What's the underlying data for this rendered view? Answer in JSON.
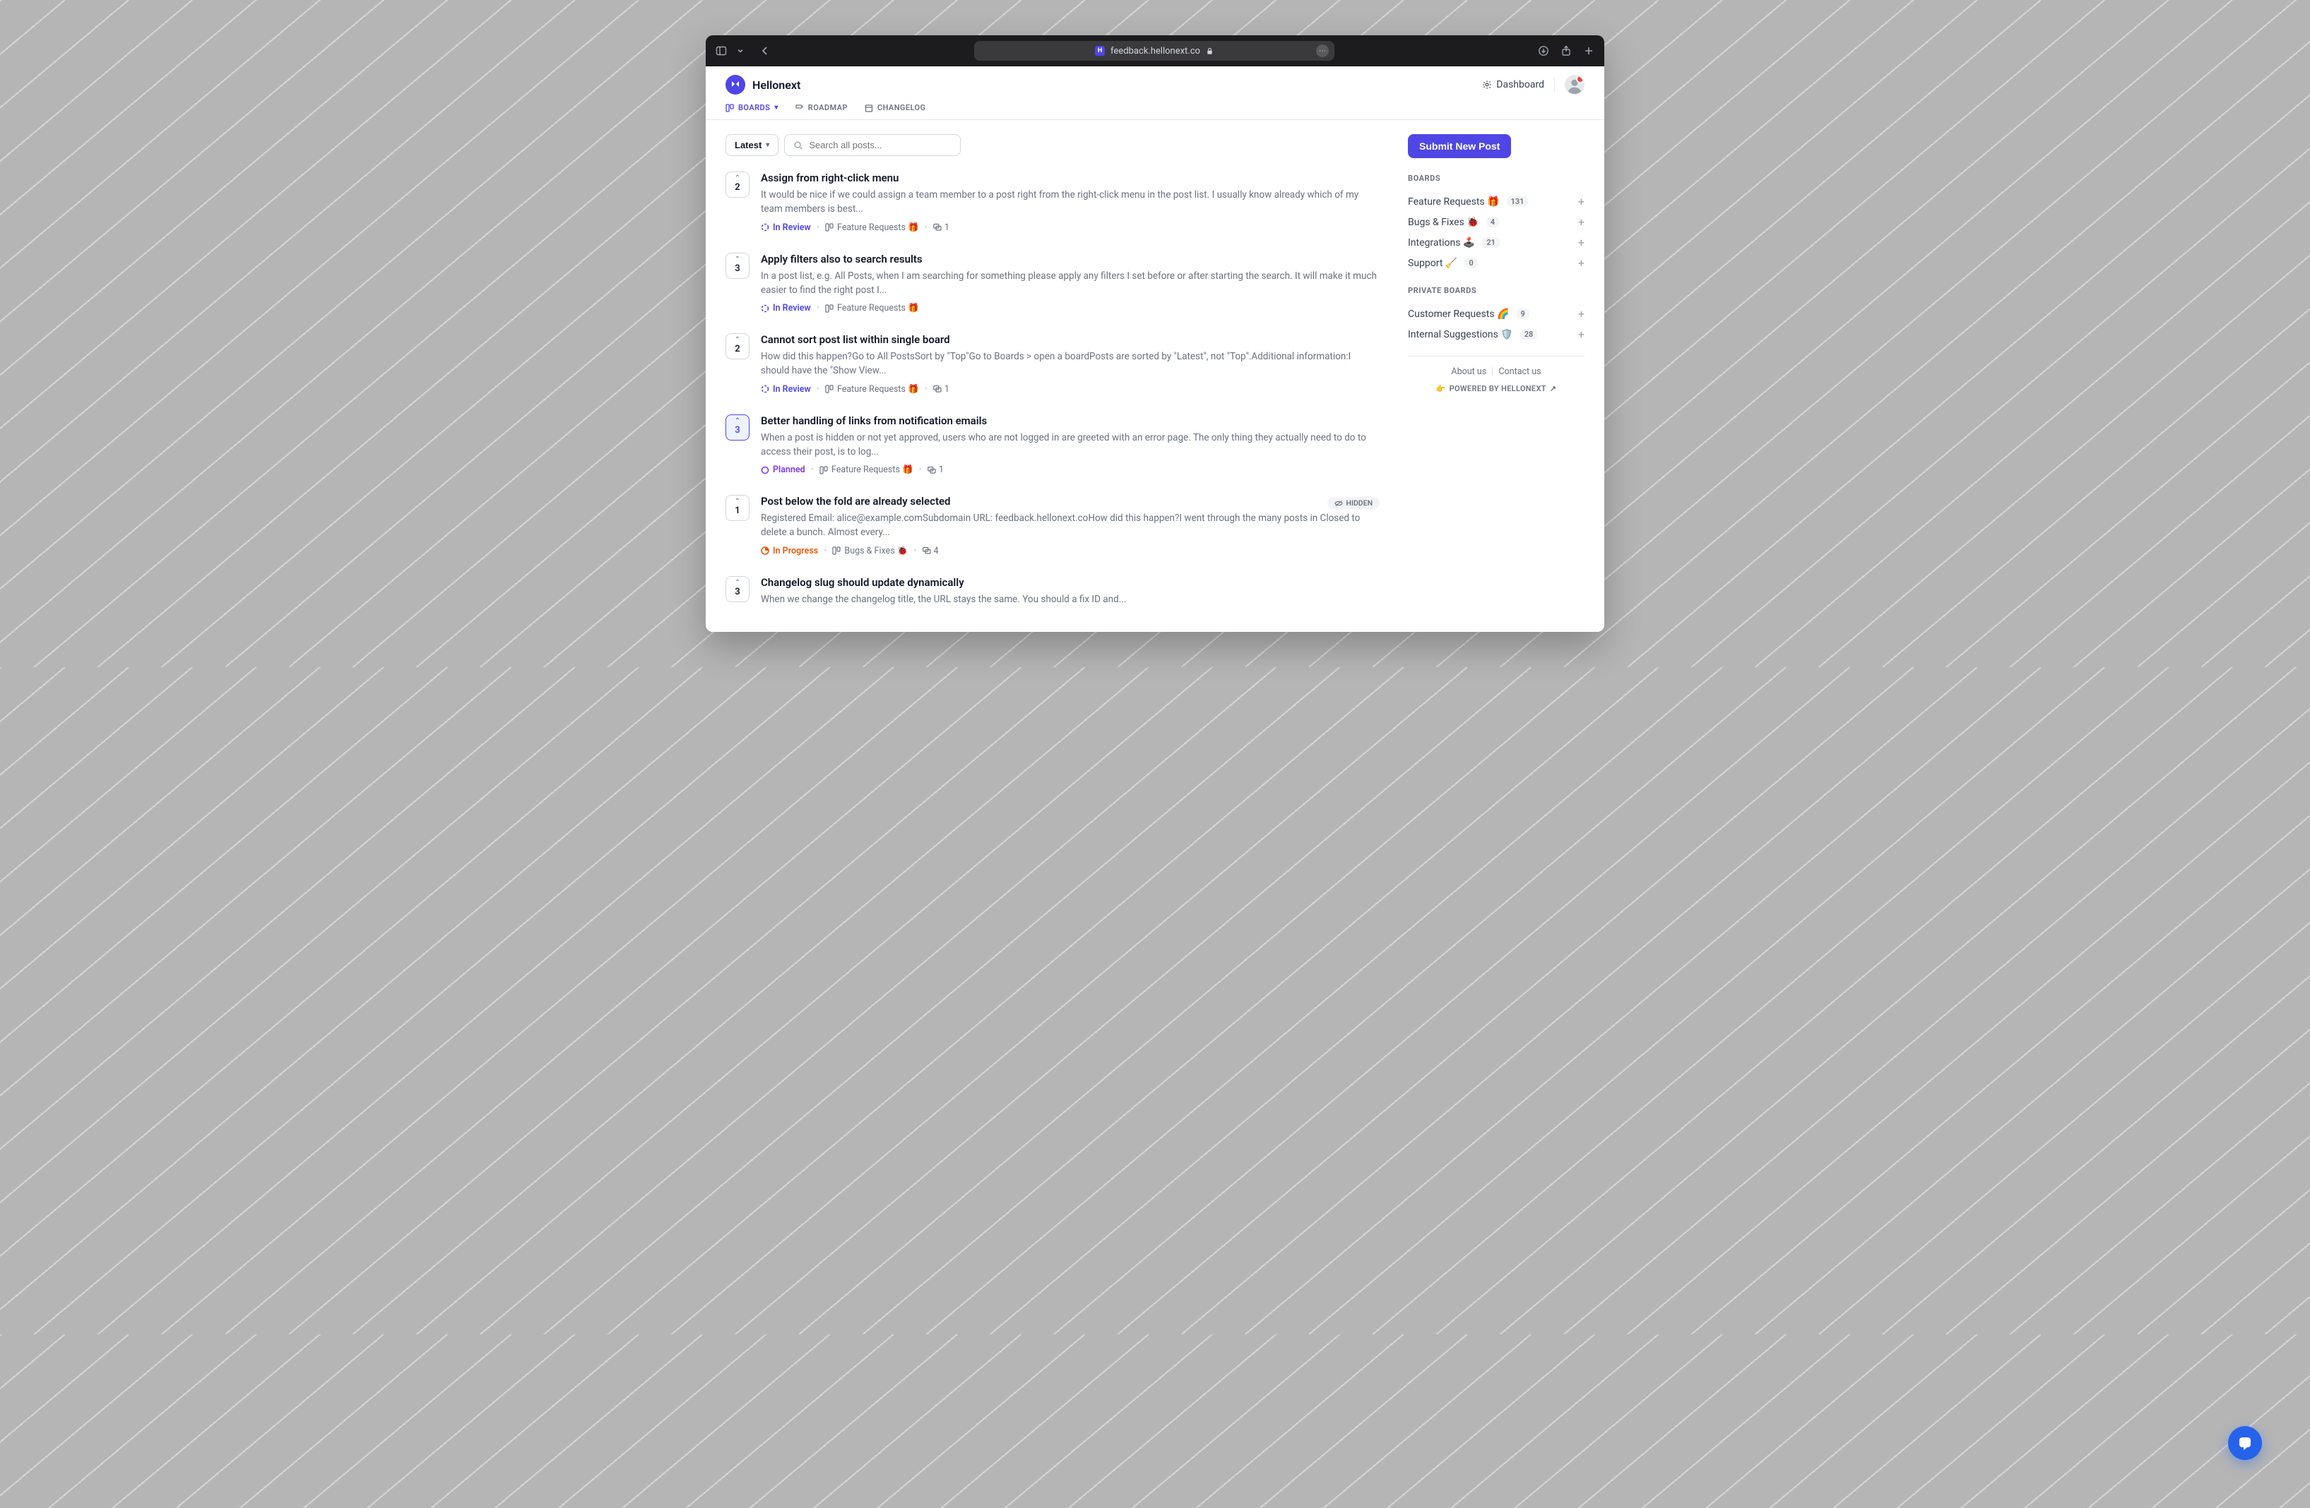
{
  "browser": {
    "url_host": "feedback.hellonext.co"
  },
  "brand": {
    "name": "Hellonext"
  },
  "top": {
    "dashboard": "Dashboard"
  },
  "nav": {
    "boards": "BOARDS",
    "roadmap": "ROADMAP",
    "changelog": "CHANGELOG"
  },
  "controls": {
    "sort_label": "Latest",
    "search_placeholder": "Search all posts..."
  },
  "statuses": {
    "in_review": "In Review",
    "planned": "Planned",
    "in_progress": "In Progress"
  },
  "board_labels": {
    "feature_requests": "Feature Requests 🎁",
    "bugs_fixes": "Bugs & Fixes 🐞"
  },
  "posts": [
    {
      "votes": 2,
      "selected": false,
      "title": "Assign from right-click menu",
      "excerpt": "It would be nice if we could assign a team member to a post right from the right-click menu in the post list. I usually know already which of my team members is best...",
      "status": "in_review",
      "board": "feature_requests",
      "comments": 1,
      "hidden": false
    },
    {
      "votes": 3,
      "selected": false,
      "title": "Apply filters also to search results",
      "excerpt": "In a post list, e.g. All Posts, when I am searching for something please apply any filters I set before or after starting the search. It will make it much easier to find the right post I...",
      "status": "in_review",
      "board": "feature_requests",
      "comments": null,
      "hidden": false
    },
    {
      "votes": 2,
      "selected": false,
      "title": "Cannot sort post list within single board",
      "excerpt": "How did this happen?Go to All PostsSort by \"Top\"Go to Boards > open a boardPosts are sorted by \"Latest\", not \"Top\".Additional information:I should have the \"Show View...",
      "status": "in_review",
      "board": "feature_requests",
      "comments": 1,
      "hidden": false
    },
    {
      "votes": 3,
      "selected": true,
      "title": "Better handling of links from notification emails",
      "excerpt": "When a post is hidden or not yet approved, users who are not logged in are greeted with an error page. The only thing they actually need to do to access their post, is to log...",
      "status": "planned",
      "board": "feature_requests",
      "comments": 1,
      "hidden": false
    },
    {
      "votes": 1,
      "selected": false,
      "title": "Post below the fold are already selected",
      "excerpt": "Registered Email: alice@example.comSubdomain URL: feedback.hellonext.coHow did this happen?I went through the many posts in Closed to delete a bunch. Almost every...",
      "status": "in_progress",
      "board": "bugs_fixes",
      "comments": 4,
      "hidden": true
    },
    {
      "votes": 3,
      "selected": false,
      "title": "Changelog slug should update dynamically",
      "excerpt": "When we change the changelog title, the URL stays the same. You should a fix ID and...",
      "status": null,
      "board": null,
      "comments": null,
      "hidden": false
    }
  ],
  "hidden_label": "HIDDEN",
  "sidebar": {
    "submit": "Submit New Post",
    "boards_heading": "BOARDS",
    "private_heading": "PRIVATE BOARDS",
    "boards": [
      {
        "name": "Feature Requests 🎁",
        "count": 131
      },
      {
        "name": "Bugs & Fixes 🐞",
        "count": 4
      },
      {
        "name": "Integrations 🕹️",
        "count": 21
      },
      {
        "name": "Support 🧹",
        "count": 0
      }
    ],
    "private_boards": [
      {
        "name": "Customer Requests 🌈",
        "count": 9
      },
      {
        "name": "Internal Suggestions 🛡️",
        "count": 28
      }
    ],
    "about": "About us",
    "contact": "Contact us",
    "powered": "POWERED BY HELLONEXT"
  }
}
